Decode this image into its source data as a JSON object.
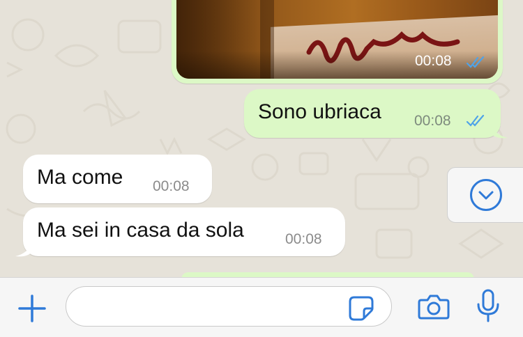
{
  "colors": {
    "outgoing_bubble": "#dcf8c6",
    "incoming_bubble": "#ffffff",
    "chat_background": "#e6e2d9",
    "read_ticks": "#4fa3e8",
    "accent_blue": "#2f7ad8"
  },
  "messages": [
    {
      "type": "image",
      "direction": "outgoing",
      "time": "00:08",
      "status": "read"
    },
    {
      "type": "text",
      "direction": "outgoing",
      "text": "Sono ubriaca",
      "time": "00:08",
      "status": "read"
    },
    {
      "type": "text",
      "direction": "incoming",
      "text": "Ma come",
      "time": "00:08"
    },
    {
      "type": "text",
      "direction": "incoming",
      "text": "Ma sei in casa da sola",
      "time": "00:08"
    }
  ],
  "icons": {
    "scroll_down": "chevron-down-circle-icon",
    "attach": "plus-icon",
    "sticker": "sticker-icon",
    "camera": "camera-icon",
    "microphone": "microphone-icon",
    "read_status": "double-check-icon"
  },
  "composer": {
    "value": "",
    "placeholder": ""
  }
}
